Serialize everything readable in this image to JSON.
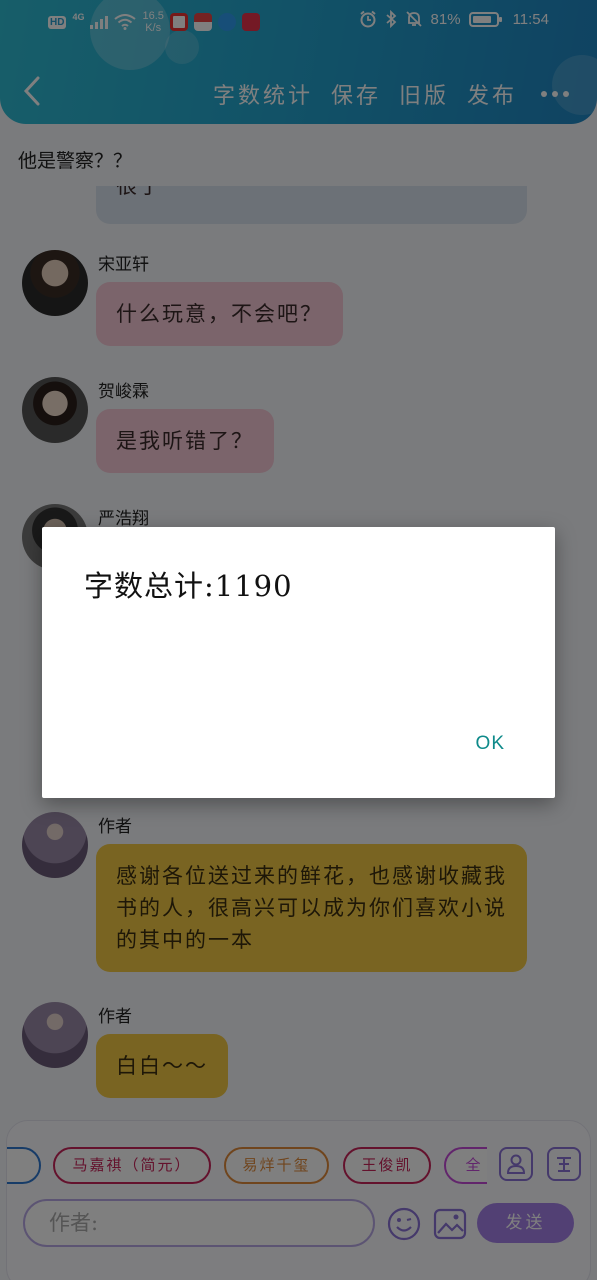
{
  "status_bar": {
    "hd_label": "HD",
    "network_label": "4G",
    "net_speed_value": "16.5",
    "net_speed_unit": "K/s",
    "battery_percent": "81%",
    "time": "11:54"
  },
  "header": {
    "actions": [
      "字数统计",
      "保存",
      "旧版",
      "发布"
    ]
  },
  "chat_title": "他是警察？？",
  "partial_message": {
    "text": "很了"
  },
  "messages": [
    {
      "sender": "宋亚轩",
      "text": "什么玩意，不会吧？",
      "style": "pink"
    },
    {
      "sender": "贺峻霖",
      "text": "是我听错了？",
      "style": "pink"
    },
    {
      "sender": "严浩翔",
      "text": "",
      "style": "gray"
    },
    {
      "sender": "作者",
      "text": "感谢各位送过来的鲜花，也感谢收藏我书的人，很高兴可以成为你们喜欢小说的其中的一本",
      "style": "gold"
    },
    {
      "sender": "作者",
      "text": "白白～～",
      "style": "gold"
    }
  ],
  "role_chips": [
    "马嘉祺（简元）",
    "易烊千玺",
    "王俊凯",
    "全"
  ],
  "input": {
    "placeholder": "作者:"
  },
  "send_label": "发送",
  "dialog": {
    "message": "字数总计:1190",
    "ok_label": "OK"
  },
  "colors": {
    "header_start": "#2fbcd3",
    "header_end": "#1f86c4",
    "bubble_pink": "#f6c9d7",
    "bubble_gray": "#d9e2ee",
    "bubble_gold": "#f2c944",
    "send_button": "#a481e8",
    "ok_text": "#0e8a8a"
  },
  "icons": [
    "back-arrow-icon",
    "more-icon",
    "emoji-icon",
    "image-icon",
    "person-icon",
    "tag-icon",
    "wifi-icon",
    "alarm-icon",
    "bluetooth-icon",
    "mute-icon",
    "battery-icon"
  ]
}
